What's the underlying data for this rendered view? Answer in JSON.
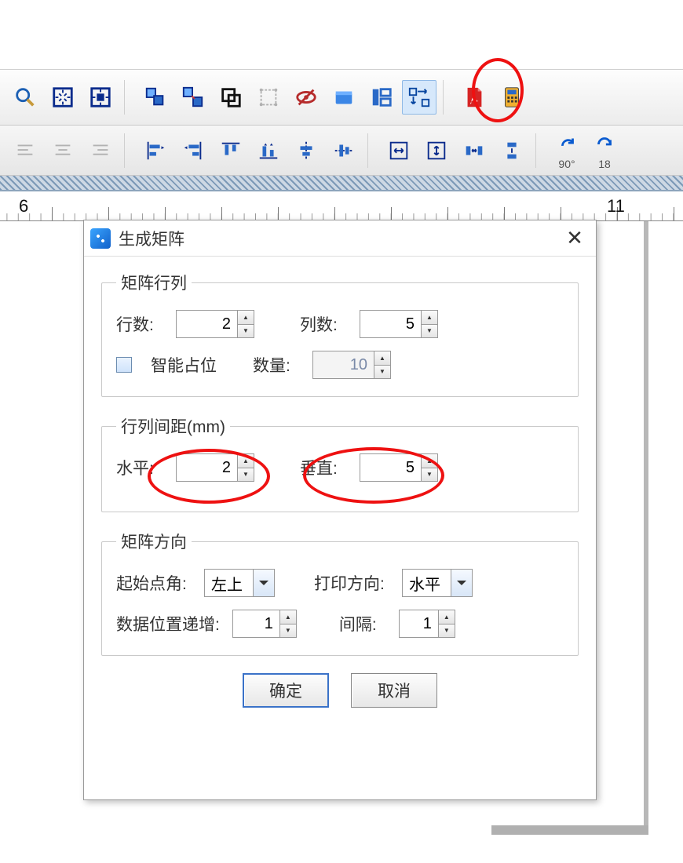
{
  "ruler": {
    "marks": [
      "6",
      "11"
    ]
  },
  "toolbar2_labels": {
    "rotate90": "90°",
    "rotate180": "18"
  },
  "dialog": {
    "title": "生成矩阵",
    "group1": {
      "legend": "矩阵行列",
      "rows_label": "行数:",
      "rows_value": "2",
      "cols_label": "列数:",
      "cols_value": "5",
      "smart_label": "智能占位",
      "qty_label": "数量:",
      "qty_value": "10"
    },
    "group2": {
      "legend": "行列间距(mm)",
      "h_label": "水平:",
      "h_value": "2",
      "v_label": "垂直:",
      "v_value": "5"
    },
    "group3": {
      "legend": "矩阵方向",
      "start_label": "起始点角:",
      "start_value": "左上",
      "dir_label": "打印方向:",
      "dir_value": "水平",
      "inc_label": "数据位置递增:",
      "inc_value": "1",
      "gap_label": "间隔:",
      "gap_value": "1"
    },
    "ok": "确定",
    "cancel": "取消"
  }
}
